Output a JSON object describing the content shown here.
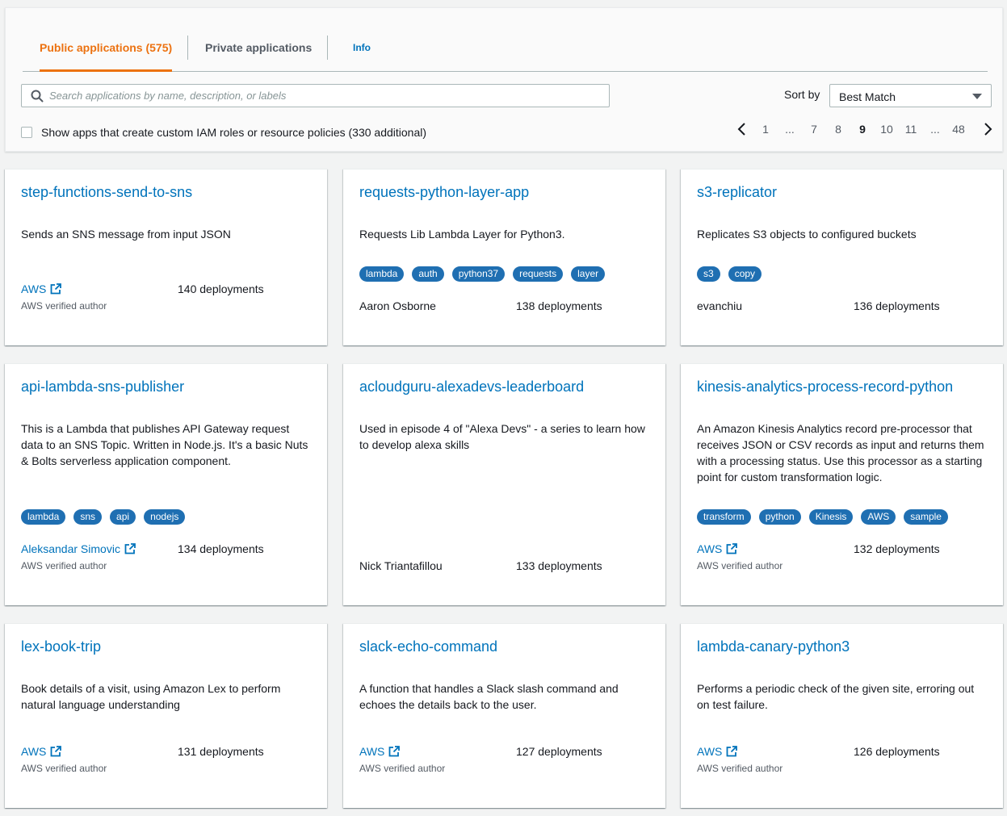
{
  "tabs": {
    "public_label": "Public applications (575)",
    "private_label": "Private applications",
    "info_label": "Info"
  },
  "search": {
    "placeholder": "Search applications by name, description, or labels",
    "value": ""
  },
  "sort": {
    "label": "Sort by",
    "selected": "Best Match"
  },
  "filter": {
    "checkbox_label": "Show apps that create custom IAM roles or resource policies (330 additional)",
    "checked": false
  },
  "pagination": {
    "pages": [
      "1",
      "...",
      "7",
      "8",
      "9",
      "10",
      "11",
      "...",
      "48"
    ],
    "current": "9"
  },
  "cards": [
    {
      "title": "step-functions-send-to-sns",
      "description": "Sends an SNS message from input JSON",
      "labels": [],
      "author": "AWS",
      "author_is_link": true,
      "verified": "AWS verified author",
      "deployments": "140 deployments"
    },
    {
      "title": "requests-python-layer-app",
      "description": "Requests Lib Lambda Layer for Python3.",
      "labels": [
        "lambda",
        "auth",
        "python37",
        "requests",
        "layer"
      ],
      "author": "Aaron Osborne",
      "author_is_link": false,
      "verified": "",
      "deployments": "138 deployments"
    },
    {
      "title": "s3-replicator",
      "description": "Replicates S3 objects to configured buckets",
      "labels": [
        "s3",
        "copy"
      ],
      "author": "evanchiu",
      "author_is_link": false,
      "verified": "",
      "deployments": "136 deployments"
    },
    {
      "title": "api-lambda-sns-publisher",
      "description": "This is a Lambda that publishes API Gateway request data to an SNS Topic. Written in Node.js. It's a basic Nuts & Bolts serverless application component.",
      "labels": [
        "lambda",
        "sns",
        "api",
        "nodejs"
      ],
      "author": "Aleksandar Simovic",
      "author_is_link": true,
      "verified": "AWS verified author",
      "deployments": "134 deployments"
    },
    {
      "title": "acloudguru-alexadevs-leaderboard",
      "description": "Used in episode 4 of \"Alexa Devs\" - a series to learn how to develop alexa skills",
      "labels": [],
      "author": "Nick Triantafillou",
      "author_is_link": false,
      "verified": "",
      "deployments": "133 deployments"
    },
    {
      "title": "kinesis-analytics-process-record-python",
      "description": "An Amazon Kinesis Analytics record pre-processor that receives JSON or CSV records as input and returns them with a processing status. Use this processor as a starting point for custom transformation logic.",
      "labels": [
        "transform",
        "python",
        "Kinesis",
        "AWS",
        "sample"
      ],
      "author": "AWS",
      "author_is_link": true,
      "verified": "AWS verified author",
      "deployments": "132 deployments"
    },
    {
      "title": "lex-book-trip",
      "description": "Book details of a visit, using Amazon Lex to perform natural language understanding",
      "labels": [],
      "author": "AWS",
      "author_is_link": true,
      "verified": "AWS verified author",
      "deployments": "131 deployments"
    },
    {
      "title": "slack-echo-command",
      "description": "A function that handles a Slack slash command and echoes the details back to the user.",
      "labels": [],
      "author": "AWS",
      "author_is_link": true,
      "verified": "AWS verified author",
      "deployments": "127 deployments"
    },
    {
      "title": "lambda-canary-python3",
      "description": "Performs a periodic check of the given site, erroring out on test failure.",
      "labels": [],
      "author": "AWS",
      "author_is_link": true,
      "verified": "AWS verified author",
      "deployments": "126 deployments"
    }
  ]
}
